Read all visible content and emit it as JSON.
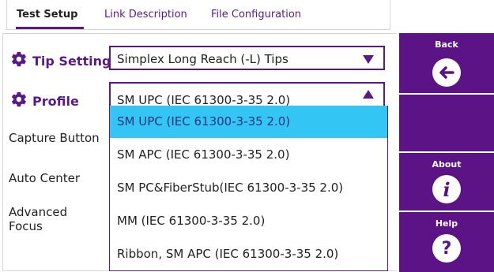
{
  "tabs": [
    {
      "label": "Test Setup",
      "active": true
    },
    {
      "label": "Link Description",
      "active": false
    },
    {
      "label": "File Configuration",
      "active": false
    }
  ],
  "settings": {
    "tip_setting": {
      "label": "Tip Setting",
      "value": "Simplex Long Reach (-L) Tips",
      "icon": "gear-icon"
    },
    "profile": {
      "label": "Profile",
      "value": "SM UPC (IEC 61300-3-35 2.0)",
      "icon": "gear-icon",
      "expanded": true
    },
    "capture_button": {
      "label": "Capture Button"
    },
    "auto_center": {
      "label": "Auto Center"
    },
    "advanced_focus": {
      "label": "Advanced\nFocus",
      "line1": "Advanced",
      "line2": "Focus"
    }
  },
  "profile_options": [
    {
      "label": "SM UPC (IEC 61300-3-35 2.0)",
      "selected": true
    },
    {
      "label": "SM APC (IEC 61300-3-35 2.0)",
      "selected": false
    },
    {
      "label": "SM PC&FiberStub(IEC 61300-3-35 2.0)",
      "selected": false
    },
    {
      "label": "MM (IEC 61300-3-35 2.0)",
      "selected": false
    },
    {
      "label": "Ribbon, SM APC (IEC 61300-3-35 2.0)",
      "selected": false
    }
  ],
  "side_buttons": {
    "back": {
      "label": "Back",
      "icon": "arrow-left-icon"
    },
    "about": {
      "label": "About",
      "icon": "info-icon"
    },
    "help": {
      "label": "Help",
      "icon": "question-icon"
    }
  },
  "colors": {
    "brand_purple": "#5b1385",
    "selected_option": "#33c6f5"
  }
}
